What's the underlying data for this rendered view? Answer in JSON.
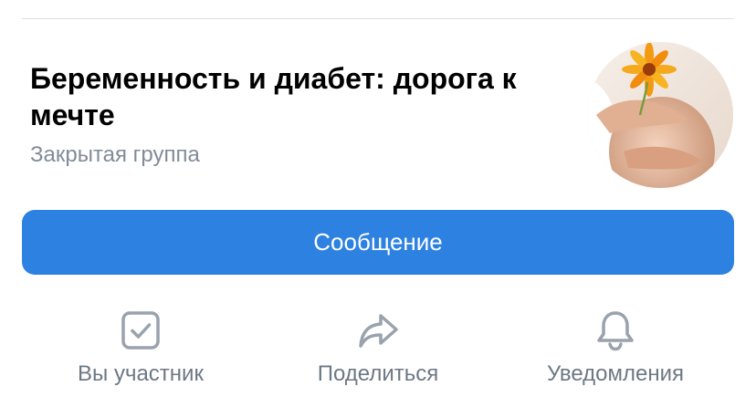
{
  "group": {
    "title": "Беременность и диабет: дорога к мечте",
    "type": "Закрытая группа",
    "avatar_icon": "group-avatar-photo"
  },
  "primary_action": {
    "label": "Сообщение"
  },
  "actions": [
    {
      "icon": "checkbox-checked-icon",
      "label": "Вы участник"
    },
    {
      "icon": "share-arrow-icon",
      "label": "Поделиться"
    },
    {
      "icon": "bell-icon",
      "label": "Уведомления"
    }
  ],
  "colors": {
    "accent": "#2d81e0",
    "secondary_text": "#818c99",
    "icon": "#99a2ad",
    "action_label": "#6d7885"
  }
}
